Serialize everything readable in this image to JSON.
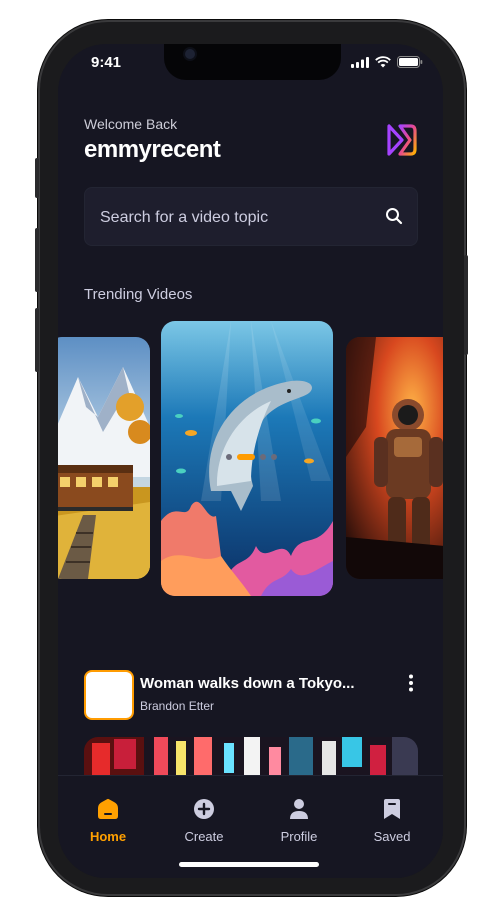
{
  "status_bar": {
    "time": "9:41"
  },
  "header": {
    "welcome": "Welcome Back",
    "username": "emmyrecent"
  },
  "search": {
    "placeholder": "Search for a video topic"
  },
  "trending": {
    "title": "Trending Videos"
  },
  "video": {
    "title": "Woman walks down a Tokyo...",
    "creator": "Brandon Etter"
  },
  "tabs": [
    {
      "label": "Home",
      "icon": "home-icon"
    },
    {
      "label": "Create",
      "icon": "plus-circle-icon"
    },
    {
      "label": "Profile",
      "icon": "profile-icon"
    },
    {
      "label": "Saved",
      "icon": "bookmark-icon"
    }
  ],
  "colors": {
    "background": "#161622",
    "accent": "#ff9c01",
    "secondary": "#cdcde0",
    "surface": "#1e1e2d"
  }
}
